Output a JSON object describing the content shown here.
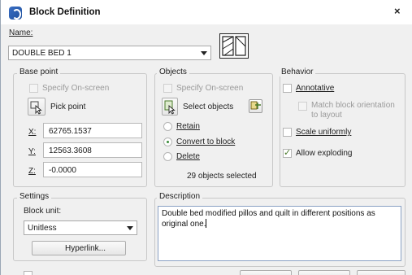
{
  "window": {
    "title": "Block Definition",
    "close_glyph": "×"
  },
  "name": {
    "label": "Name:",
    "value": "DOUBLE BED 1"
  },
  "base_point": {
    "title": "Base point",
    "specify_on_screen": "Specify On-screen",
    "pick_point": "Pick point",
    "x_label": "X:",
    "x_value": "62765.1537",
    "y_label": "Y:",
    "y_value": "12563.3608",
    "z_label": "Z:",
    "z_value": "-0.0000"
  },
  "objects": {
    "title": "Objects",
    "specify_on_screen": "Specify On-screen",
    "select_objects": "Select objects",
    "retain": "Retain",
    "convert_to_block": "Convert to block",
    "delete": "Delete",
    "selected_status": "29 objects selected",
    "selected_option": "Convert to block"
  },
  "behavior": {
    "title": "Behavior",
    "annotative": "Annotative",
    "annotative_checked": false,
    "match_orientation_line1": "Match block orientation",
    "match_orientation_line2": "to layout",
    "scale_uniformly": "Scale uniformly",
    "scale_uniformly_checked": false,
    "allow_exploding": "Allow exploding",
    "allow_exploding_checked": true
  },
  "settings": {
    "title": "Settings",
    "block_unit_label": "Block unit:",
    "block_unit_value": "Unitless",
    "hyperlink": "Hyperlink..."
  },
  "description": {
    "title": "Description",
    "text": "Double bed modified pillos and quilt in different positions as original one."
  },
  "icons": {
    "title_icon": "autocad-logo-icon",
    "pick_point_icon": "pick-point-icon",
    "select_objects_icon": "select-objects-icon",
    "quick_select_icon": "quick-select-icon",
    "preview_icon": "block-preview-icon"
  },
  "colors": {
    "accent_blue": "#3a6fc4",
    "check_green": "#4a7a2a",
    "dialog_bg": "#f0f0f0"
  }
}
